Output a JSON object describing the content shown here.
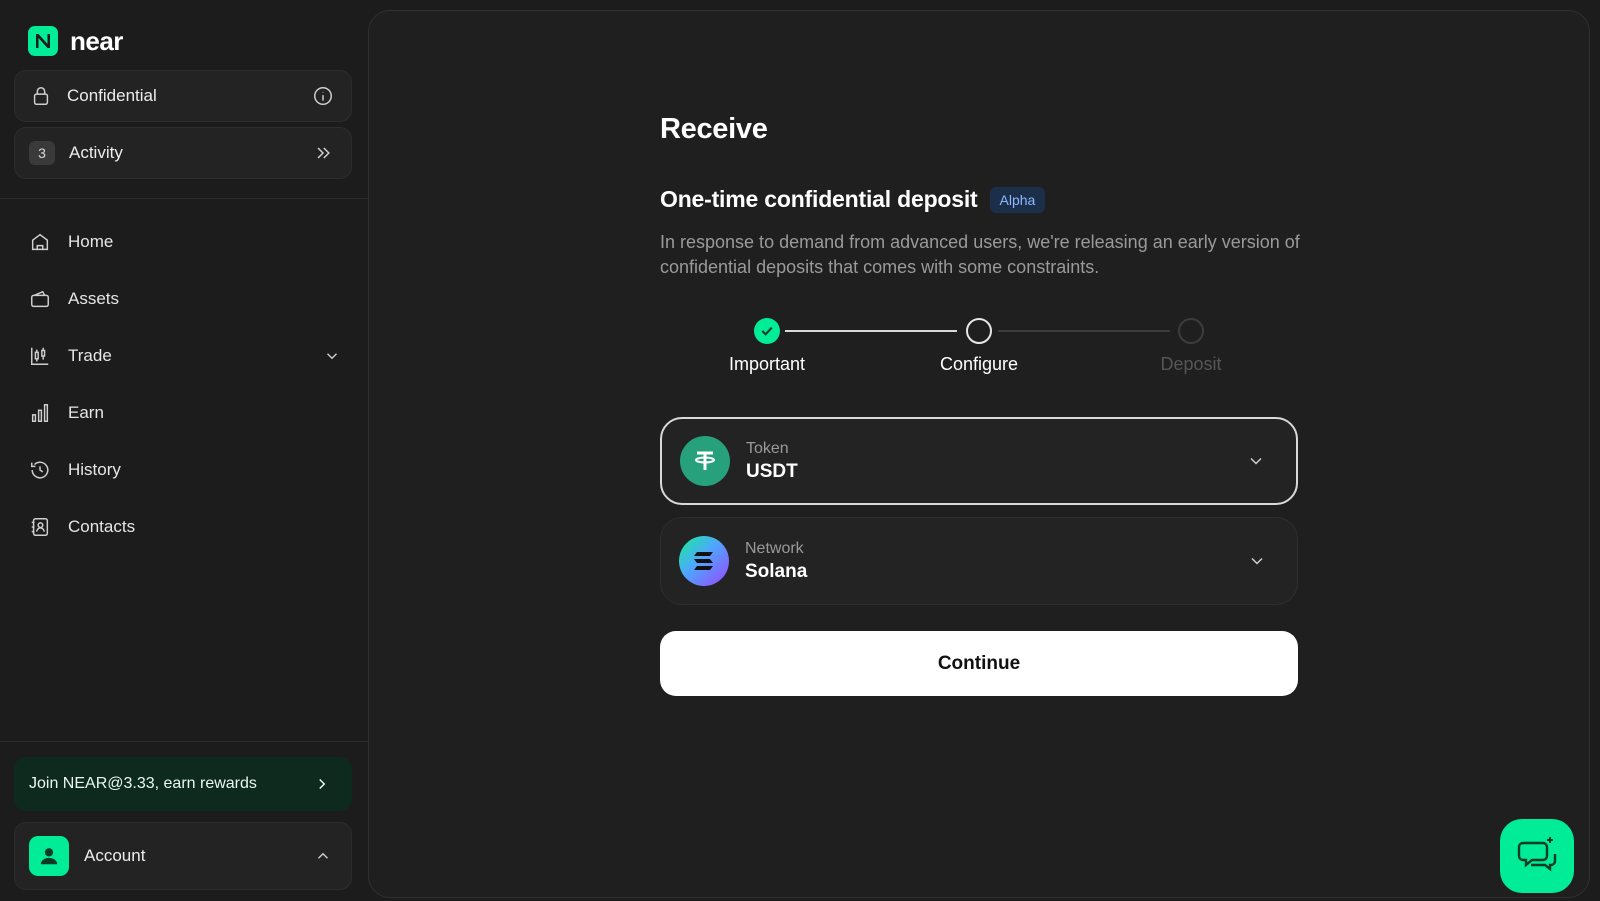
{
  "brand": {
    "name": "near",
    "accent": "#00ec97"
  },
  "sidebar": {
    "confidential_label": "Confidential",
    "activity_label": "Activity",
    "activity_count": "3",
    "nav": [
      {
        "label": "Home",
        "icon": "home-icon"
      },
      {
        "label": "Assets",
        "icon": "wallet-icon"
      },
      {
        "label": "Trade",
        "icon": "candlestick-icon"
      },
      {
        "label": "Earn",
        "icon": "bar-chart-icon"
      },
      {
        "label": "History",
        "icon": "history-icon"
      },
      {
        "label": "Contacts",
        "icon": "contacts-icon"
      }
    ],
    "promo_label": "Join NEAR@3.33, earn rewards",
    "account_label": "Account"
  },
  "main": {
    "title": "Receive",
    "section_title": "One-time confidential deposit",
    "badge": "Alpha",
    "description": "In response to demand from advanced users, we're releasing an early version of confidential deposits that comes with some constraints.",
    "steps": [
      {
        "label": "Important",
        "state": "done"
      },
      {
        "label": "Configure",
        "state": "current"
      },
      {
        "label": "Deposit",
        "state": "pending"
      }
    ],
    "token": {
      "caption": "Token",
      "value": "USDT"
    },
    "network": {
      "caption": "Network",
      "value": "Solana"
    },
    "continue_label": "Continue"
  }
}
